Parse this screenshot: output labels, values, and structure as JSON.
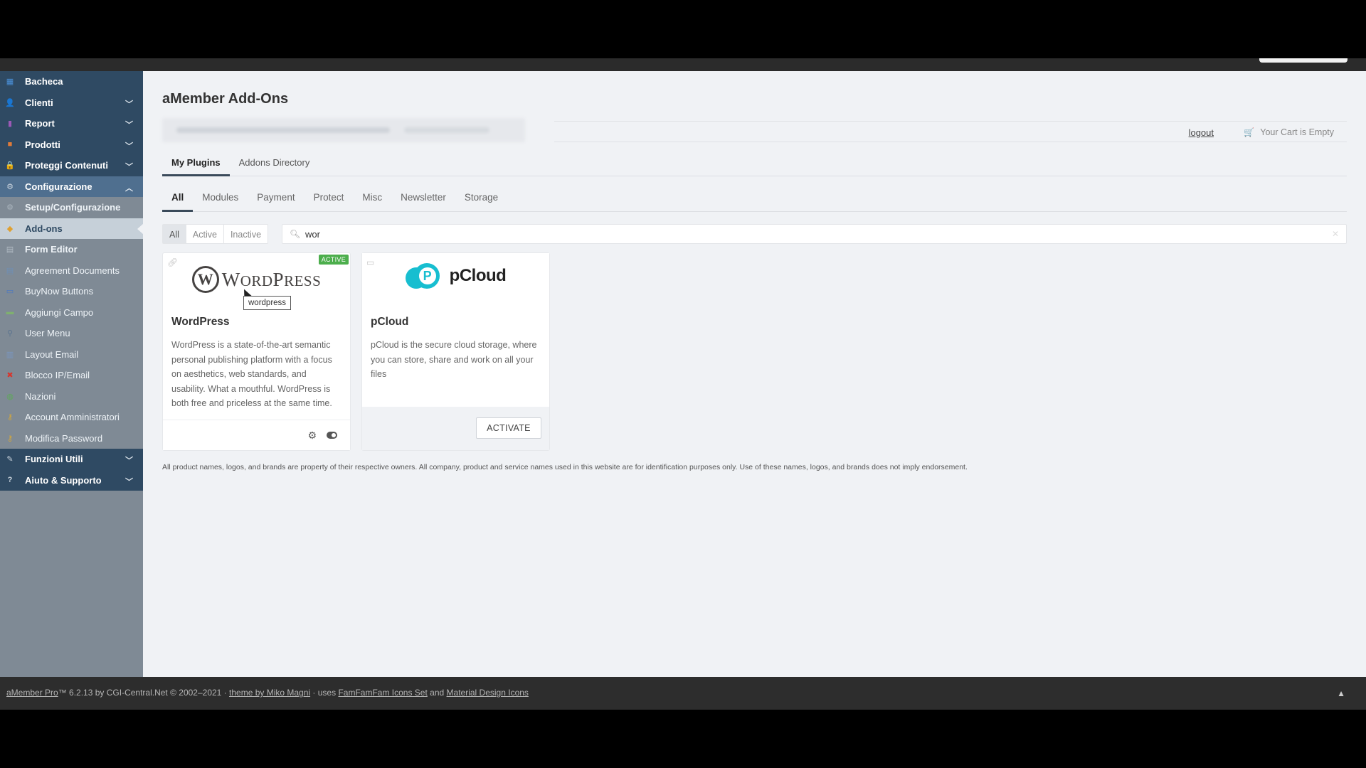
{
  "sidebar": {
    "items": [
      {
        "label": "Bacheca",
        "icon": "dashboard-icon",
        "type": "top",
        "chevron": false
      },
      {
        "label": "Clienti",
        "icon": "users-icon",
        "type": "top",
        "chevron": true
      },
      {
        "label": "Report",
        "icon": "bar-chart-icon",
        "type": "top",
        "chevron": true
      },
      {
        "label": "Prodotti",
        "icon": "box-icon",
        "type": "top",
        "chevron": true
      },
      {
        "label": "Proteggi Contenuti",
        "icon": "lock-icon",
        "type": "top",
        "chevron": true
      },
      {
        "label": "Configurazione",
        "icon": "gear-icon",
        "type": "top-open",
        "chevron": true
      },
      {
        "label": "Setup/Configurazione",
        "icon": "cog-small-icon",
        "type": "sub-bold"
      },
      {
        "label": "Add-ons",
        "icon": "package-icon",
        "type": "sub-current"
      },
      {
        "label": "Form Editor",
        "icon": "form-icon",
        "type": "sub-bold"
      },
      {
        "label": "Agreement Documents",
        "icon": "document-icon",
        "type": "sub"
      },
      {
        "label": "BuyNow Buttons",
        "icon": "button-icon",
        "type": "sub"
      },
      {
        "label": "Aggiungi Campo",
        "icon": "add-field-icon",
        "type": "sub"
      },
      {
        "label": "User Menu",
        "icon": "sitemap-icon",
        "type": "sub"
      },
      {
        "label": "Layout Email",
        "icon": "email-layout-icon",
        "type": "sub"
      },
      {
        "label": "Blocco IP/Email",
        "icon": "block-icon",
        "type": "sub"
      },
      {
        "label": "Nazioni",
        "icon": "globe-icon",
        "type": "sub"
      },
      {
        "label": "Account Amministratori",
        "icon": "admin-key-icon",
        "type": "sub"
      },
      {
        "label": "Modifica Password",
        "icon": "key-icon",
        "type": "sub"
      },
      {
        "label": "Funzioni Utili",
        "icon": "wrench-icon",
        "type": "top",
        "chevron": true
      },
      {
        "label": "Aiuto & Supporto",
        "icon": "help-icon",
        "type": "top",
        "chevron": true
      }
    ]
  },
  "page": {
    "title": "aMember Add-Ons",
    "logout_label": "logout",
    "cart_label": "Your Cart is Empty"
  },
  "tabs_primary": [
    {
      "label": "My Plugins",
      "active": true
    },
    {
      "label": "Addons Directory",
      "active": false
    }
  ],
  "tabs_category": [
    {
      "label": "All",
      "active": true
    },
    {
      "label": "Modules",
      "active": false
    },
    {
      "label": "Payment",
      "active": false
    },
    {
      "label": "Protect",
      "active": false
    },
    {
      "label": "Misc",
      "active": false
    },
    {
      "label": "Newsletter",
      "active": false
    },
    {
      "label": "Storage",
      "active": false
    }
  ],
  "status_filter": [
    "All",
    "Active",
    "Inactive"
  ],
  "search": {
    "value": "wor"
  },
  "cards": {
    "wordpress": {
      "badge": "ACTIVE",
      "logo_text": "WordPress",
      "tooltip": "wordpress",
      "name": "WordPress",
      "description": "WordPress is a state-of-the-art semantic personal publishing platform with a focus on aesthetics, web standards, and usability. What a mouthful. WordPress is both free and priceless at the same time."
    },
    "pcloud": {
      "logo_text": "pCloud",
      "name": "pCloud",
      "description": "pCloud is the secure cloud storage, where you can store, share and work on all your files",
      "activate_label": "ACTIVATE"
    }
  },
  "disclaimer": "All product names, logos, and brands are property of their respective owners. All company, product and service names used in this website are for identification purposes only. Use of these names, logos, and brands does not imply endorsement.",
  "footer": {
    "product": "aMember Pro",
    "version_text": "™ 6.2.13 by CGI-Central.Net © 2002–2021 ·",
    "theme_link": "theme by Miko Magni",
    "uses_text": "· uses",
    "icons_link": "FamFamFam Icons Set",
    "and_text": "and",
    "material_link": "Material Design Icons"
  },
  "colors": {
    "sidebar_top": "#2f4a63",
    "sidebar_bg": "#7f8a95",
    "active_badge": "#4cae4c",
    "pcloud_brand": "#17bed0"
  }
}
